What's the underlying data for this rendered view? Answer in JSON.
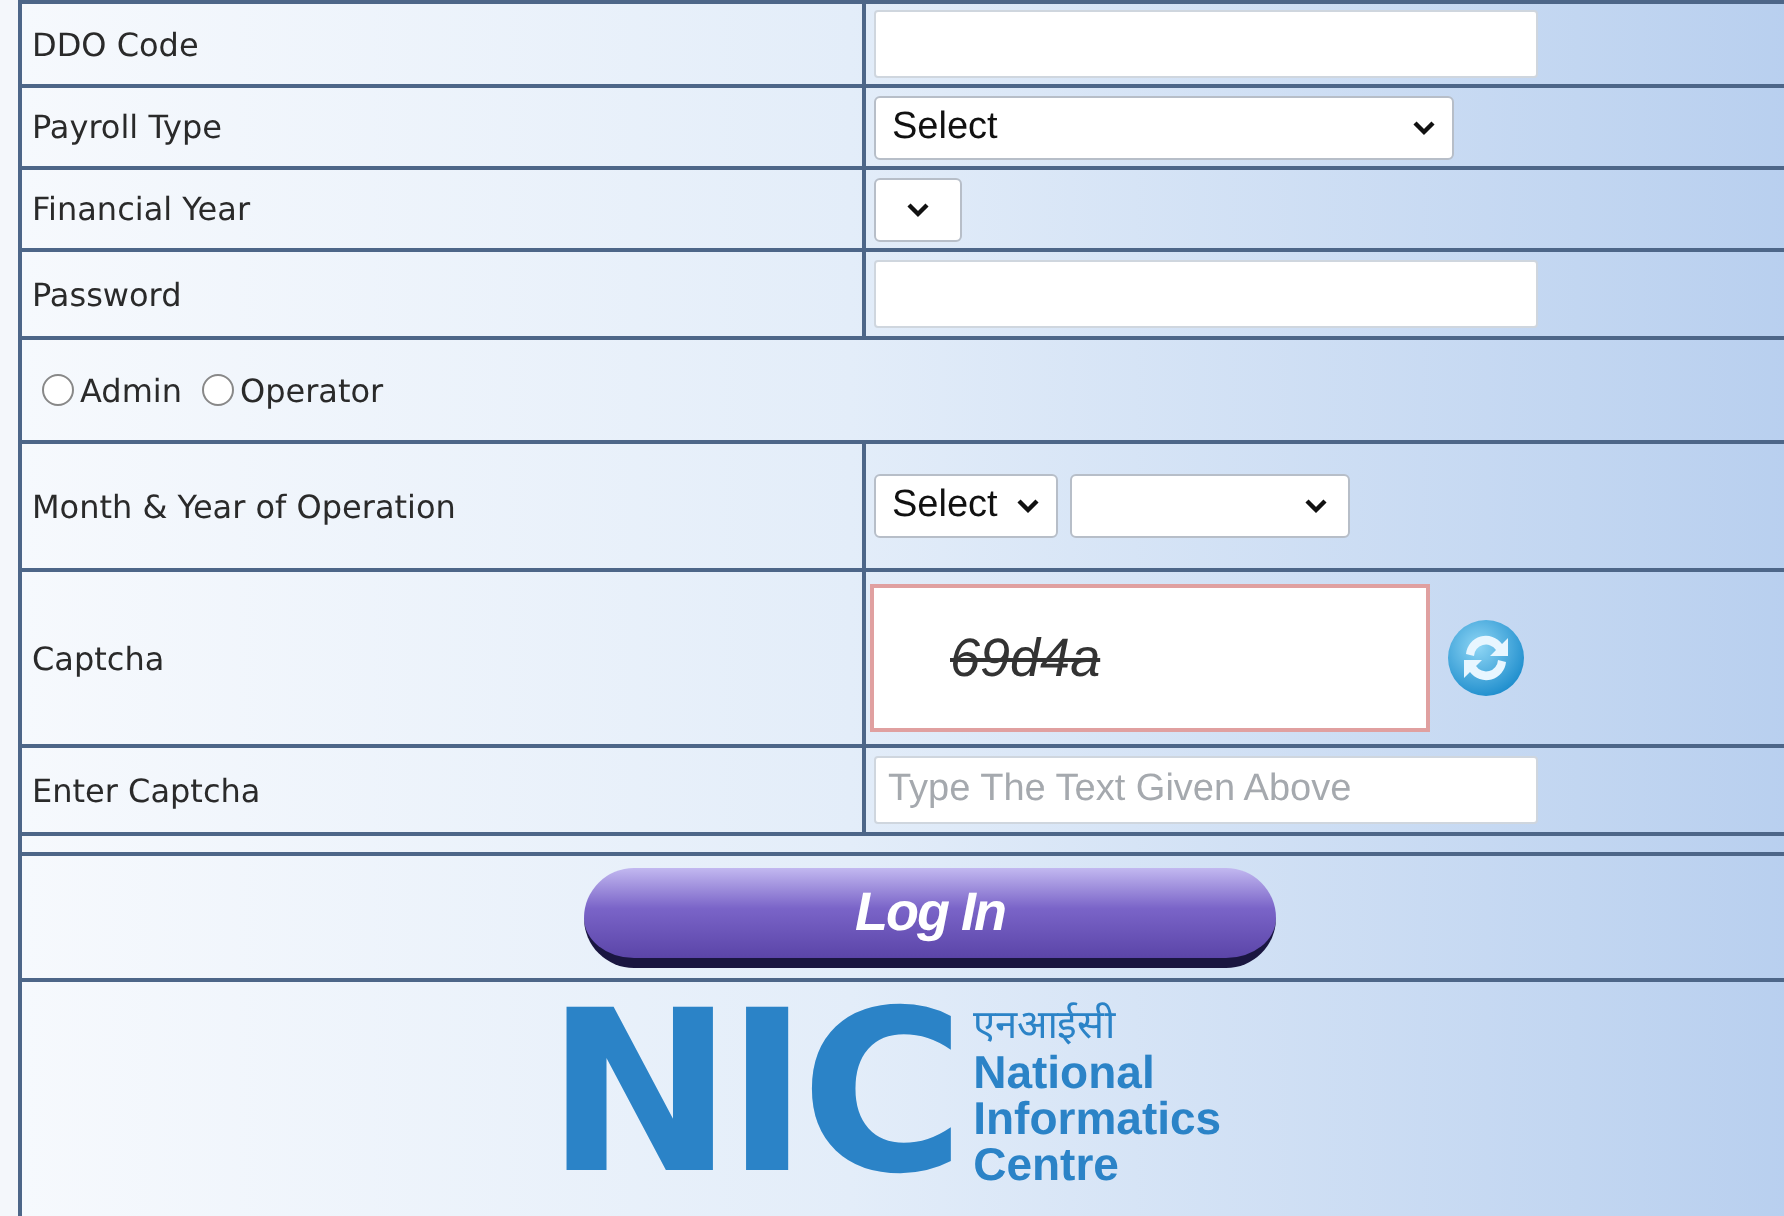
{
  "rows": [
    {
      "kind": "text",
      "label": "DDO Code"
    },
    {
      "kind": "select",
      "label": "Payroll Type",
      "value": "Select"
    },
    {
      "kind": "select",
      "label": "Financial Year"
    },
    {
      "kind": "password",
      "label": "Password"
    },
    {
      "kind": "radios",
      "options": [
        {
          "label": "Admin",
          "selected": false
        },
        {
          "label": "Operator",
          "selected": false
        }
      ]
    },
    {
      "kind": "month-year",
      "label": "Month & Year of Operation",
      "month": "Select"
    },
    {
      "kind": "captcha",
      "label": "Captcha",
      "captcha": "69d4a"
    },
    {
      "kind": "captcha-input",
      "label": "Enter Captcha",
      "placeholder": "Type The Text Given Above"
    }
  ],
  "login_button": "Log In",
  "logo": {
    "letters": "NIC",
    "hindi": "एनआईसी",
    "name_lines": [
      "National",
      "Informatics",
      "Centre"
    ]
  }
}
